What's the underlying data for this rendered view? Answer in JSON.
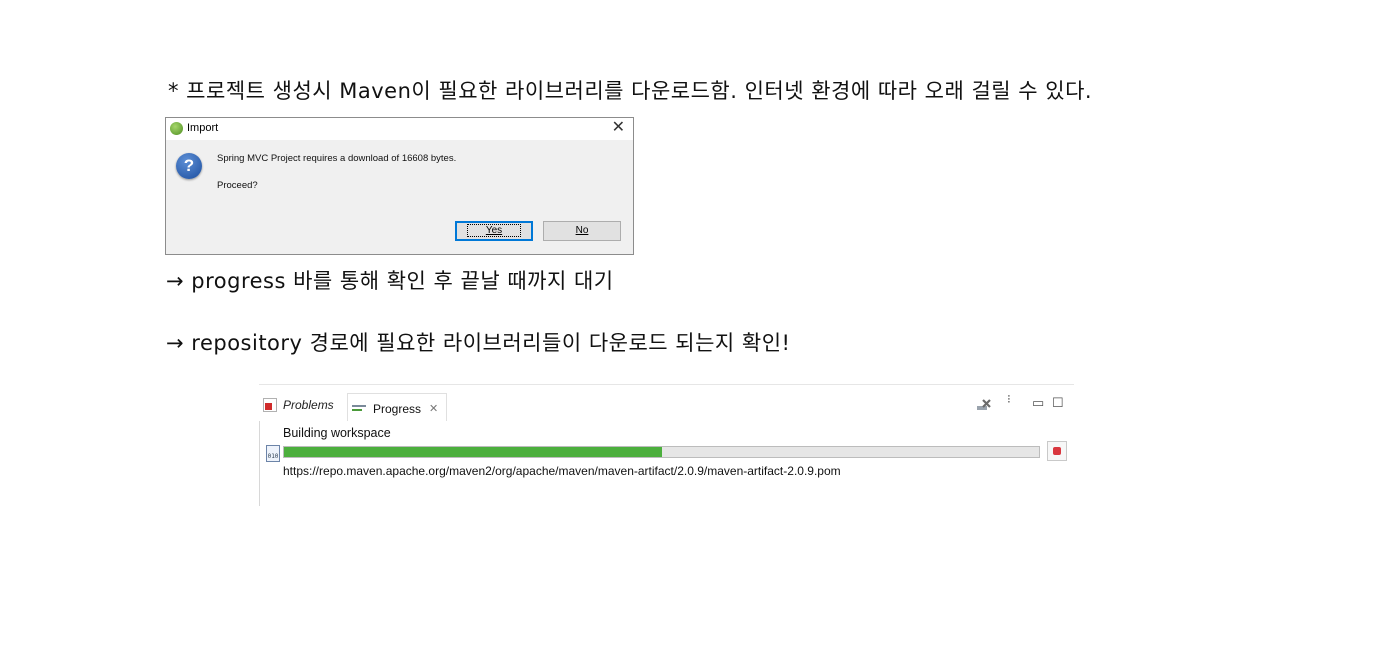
{
  "notes": {
    "line1": "* 프로젝트 생성시 Maven이 필요한 라이브러리를 다운로드함. 인터넷 환경에 따라 오래 걸릴 수 있다.",
    "line2": "→ progress 바를 통해 확인 후 끝날 때까지 대기",
    "line3": "→ repository 경로에 필요한 라이브러리들이 다운로드 되는지 확인!"
  },
  "dialog": {
    "title": "Import",
    "close_glyph": "✕",
    "message": "Spring MVC Project requires a download of 16608 bytes.",
    "question": "Proceed?",
    "yes_label": "Yes",
    "no_label": "No",
    "icon": "question-icon"
  },
  "view": {
    "tabs": [
      {
        "label": "Problems",
        "icon": "problems-icon"
      },
      {
        "label": "Progress",
        "icon": "progress-icon",
        "close_glyph": "✕"
      }
    ],
    "toolbar": {
      "clear_icon": "remove-all-finished-icon",
      "menu_icon": "view-menu-icon",
      "minimize_glyph": "▭",
      "maximize_glyph": "☐"
    },
    "job": {
      "title": "Building workspace",
      "progress": 0.5,
      "detail": "https://repo.maven.apache.org/maven2/org/apache/maven/maven-artifact/2.0.9/maven-artifact-2.0.9.pom",
      "icon": "binary-file-icon",
      "icon_text": "010"
    },
    "colors": {
      "progress_fill": "#4caf3d",
      "stop": "#d9363e"
    }
  }
}
